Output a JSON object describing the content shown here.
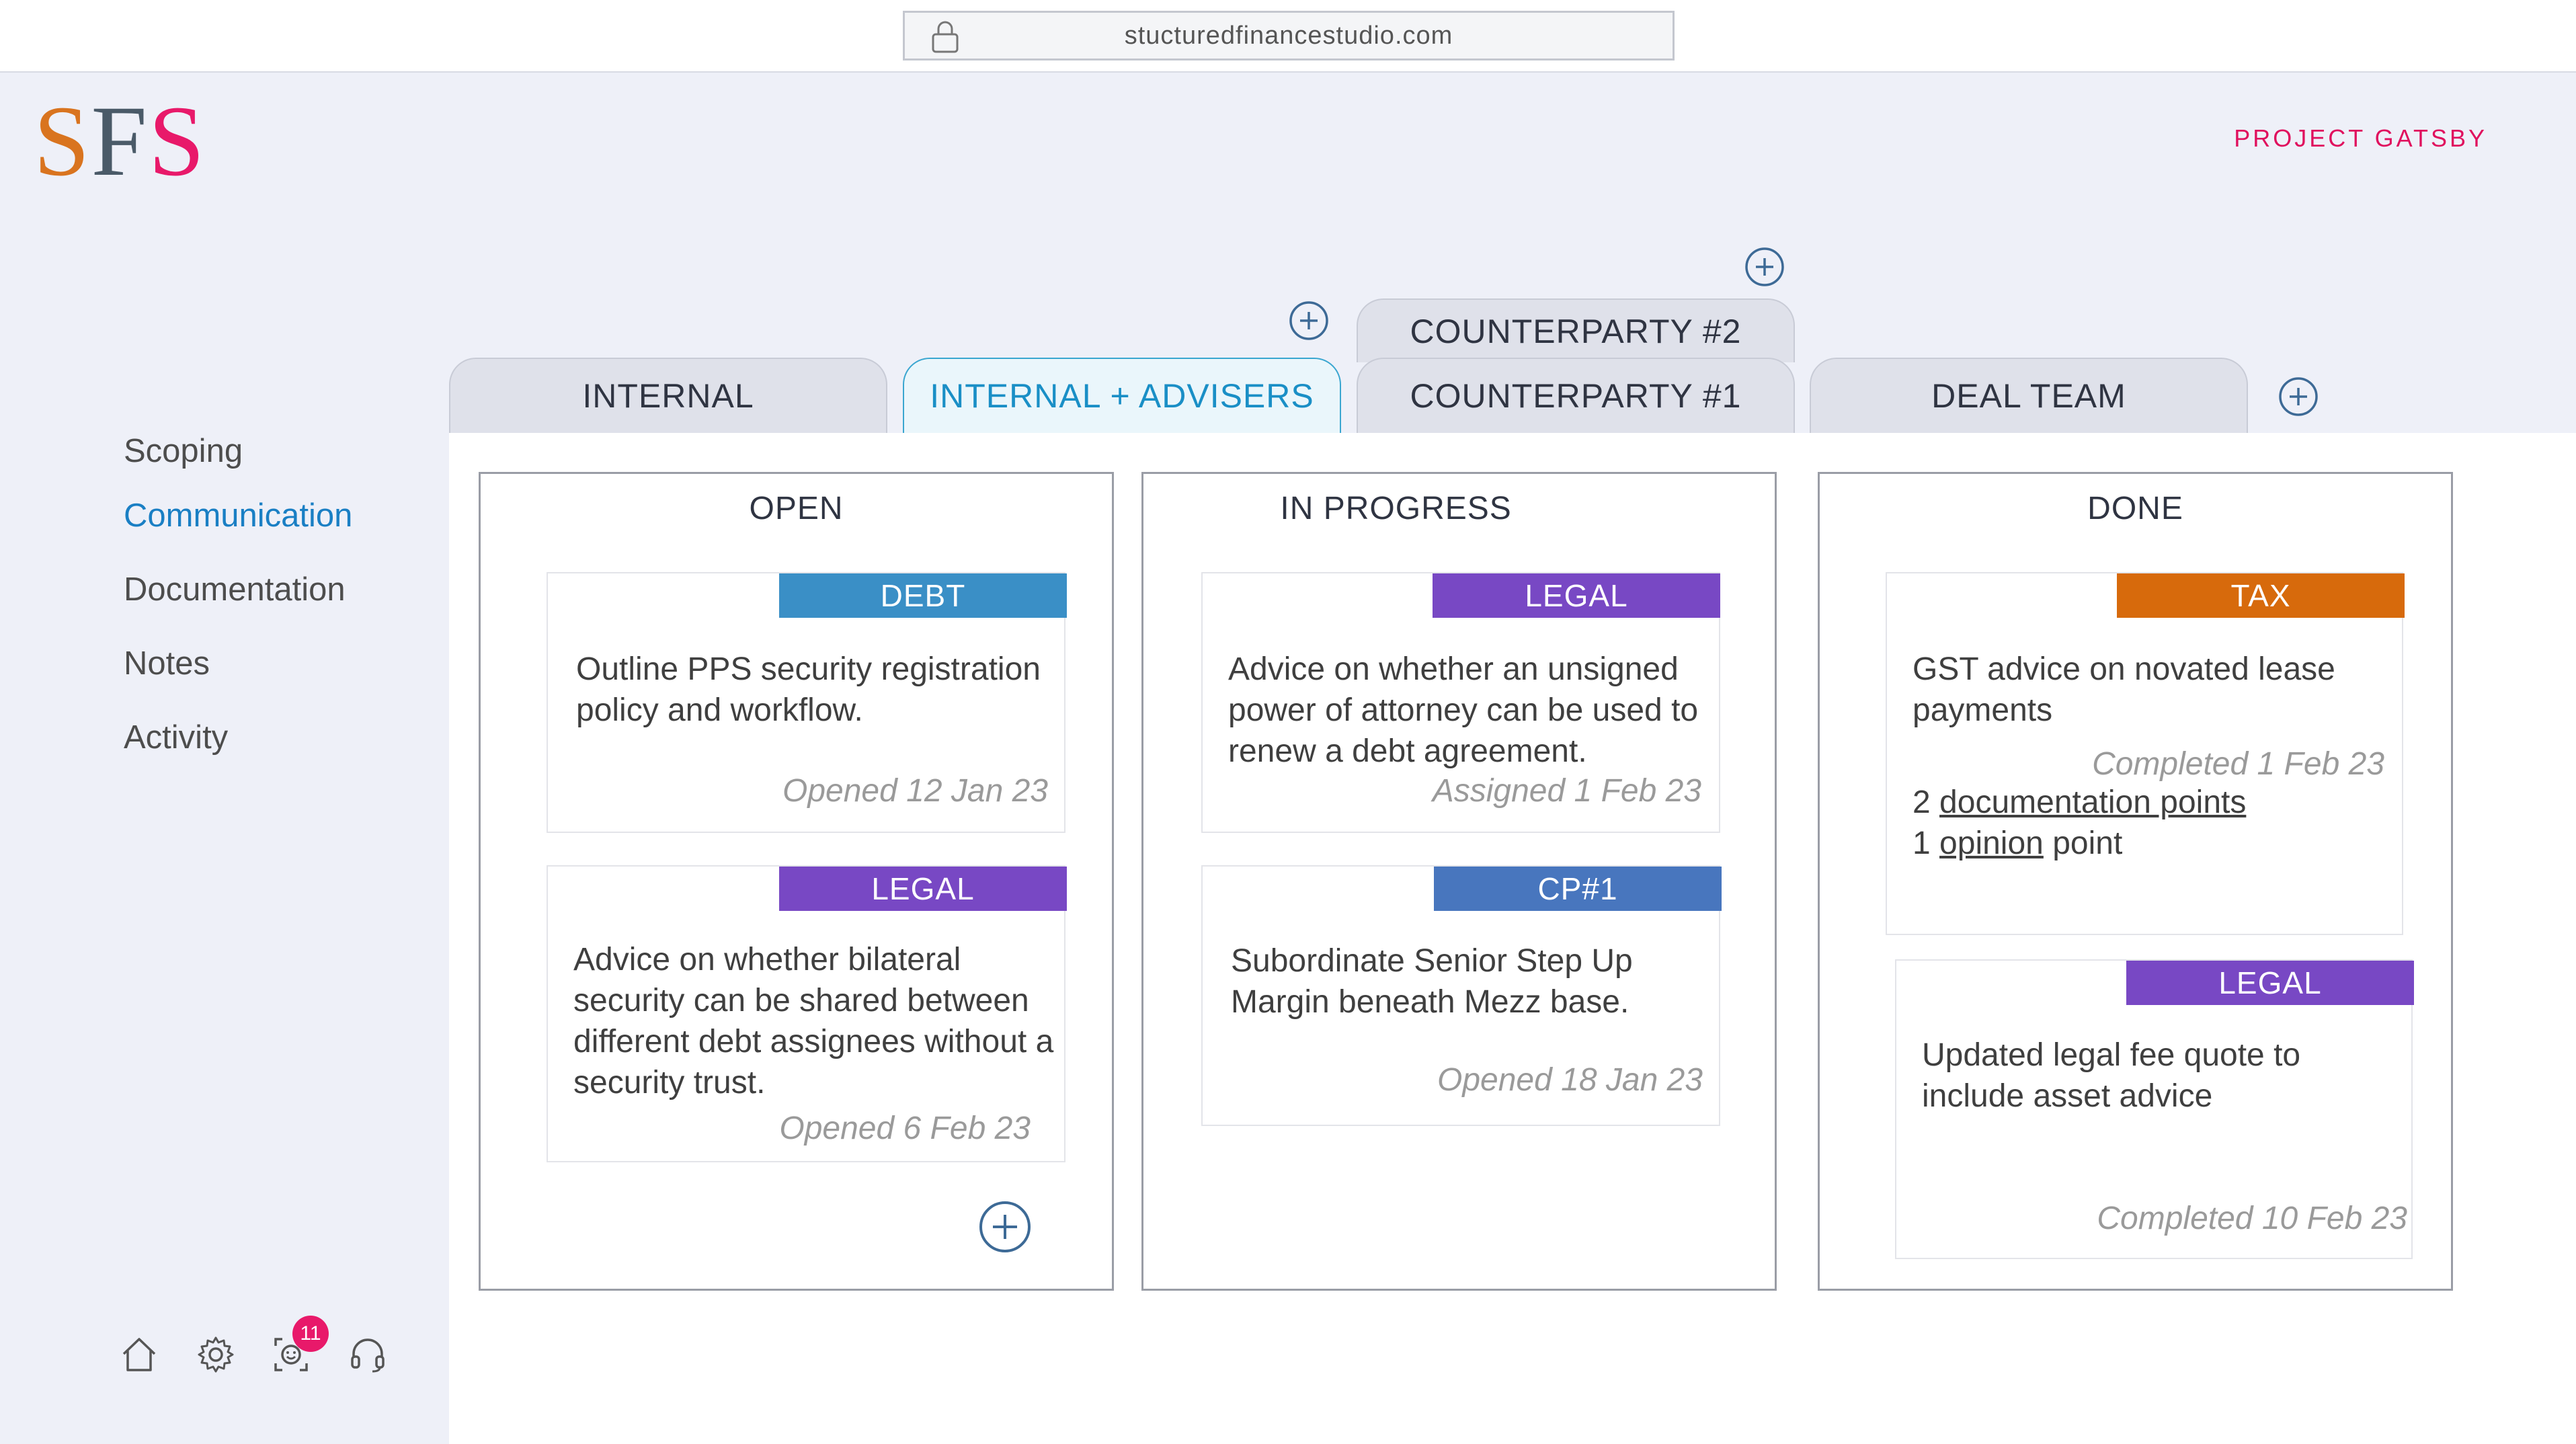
{
  "browser": {
    "url": "stucturedfinancestudio.com"
  },
  "logo": {
    "s1": "S",
    "f": "F",
    "s2": "S"
  },
  "project": {
    "title": "PROJECT GATSBY"
  },
  "sidebar": {
    "items": [
      {
        "label": "Scoping"
      },
      {
        "label": "Communication"
      },
      {
        "label": "Documentation"
      },
      {
        "label": "Notes"
      },
      {
        "label": "Activity"
      }
    ],
    "notification_count": "11"
  },
  "tabs": [
    {
      "label": "INTERNAL"
    },
    {
      "label": "INTERNAL + ADVISERS"
    },
    {
      "label": "COUNTERPARTY #2"
    },
    {
      "label": "COUNTERPARTY #1"
    },
    {
      "label": "DEAL TEAM"
    }
  ],
  "columns": {
    "open": {
      "title": "OPEN",
      "cards": [
        {
          "tag": "DEBT",
          "text": "Outline PPS security registration policy and workflow.",
          "date": "Opened 12 Jan 23"
        },
        {
          "tag": "LEGAL",
          "text": "Advice on whether bilateral security can be shared between different debt assignees without a security trust.",
          "date": "Opened 6 Feb 23"
        }
      ]
    },
    "in_progress": {
      "title": "IN PROGRESS",
      "cards": [
        {
          "tag": "LEGAL",
          "text": "Advice on whether an unsigned power of attorney can be used to renew a debt agreement.",
          "date": "Assigned 1 Feb 23"
        },
        {
          "tag": "CP#1",
          "text": "Subordinate Senior Step Up Margin beneath Mezz base.",
          "date": "Opened 18 Jan 23"
        }
      ]
    },
    "done": {
      "title": "DONE",
      "cards": [
        {
          "tag": "TAX",
          "text": "GST advice on novated lease payments",
          "date": "Completed 1 Feb 23",
          "doc_count": "2",
          "doc_link": "documentation points",
          "opinion_count": "1",
          "opinion_link": "opinion",
          "opinion_suffix": "point"
        },
        {
          "tag": "LEGAL",
          "text": "Updated legal fee quote to include asset advice",
          "date": "Completed 10 Feb 23"
        }
      ]
    }
  },
  "colors": {
    "debt": "#3a8fc6",
    "legal": "#7848c4",
    "tax": "#d76a0c",
    "cp1": "#4876be",
    "accent": "#1a7fc4",
    "brand_pink": "#e8196a"
  },
  "icons": {
    "bottom": [
      "home-icon",
      "settings-icon",
      "user-chat-icon",
      "support-headset-icon"
    ],
    "lock": "lock-icon",
    "add": "add-circle-icon"
  }
}
